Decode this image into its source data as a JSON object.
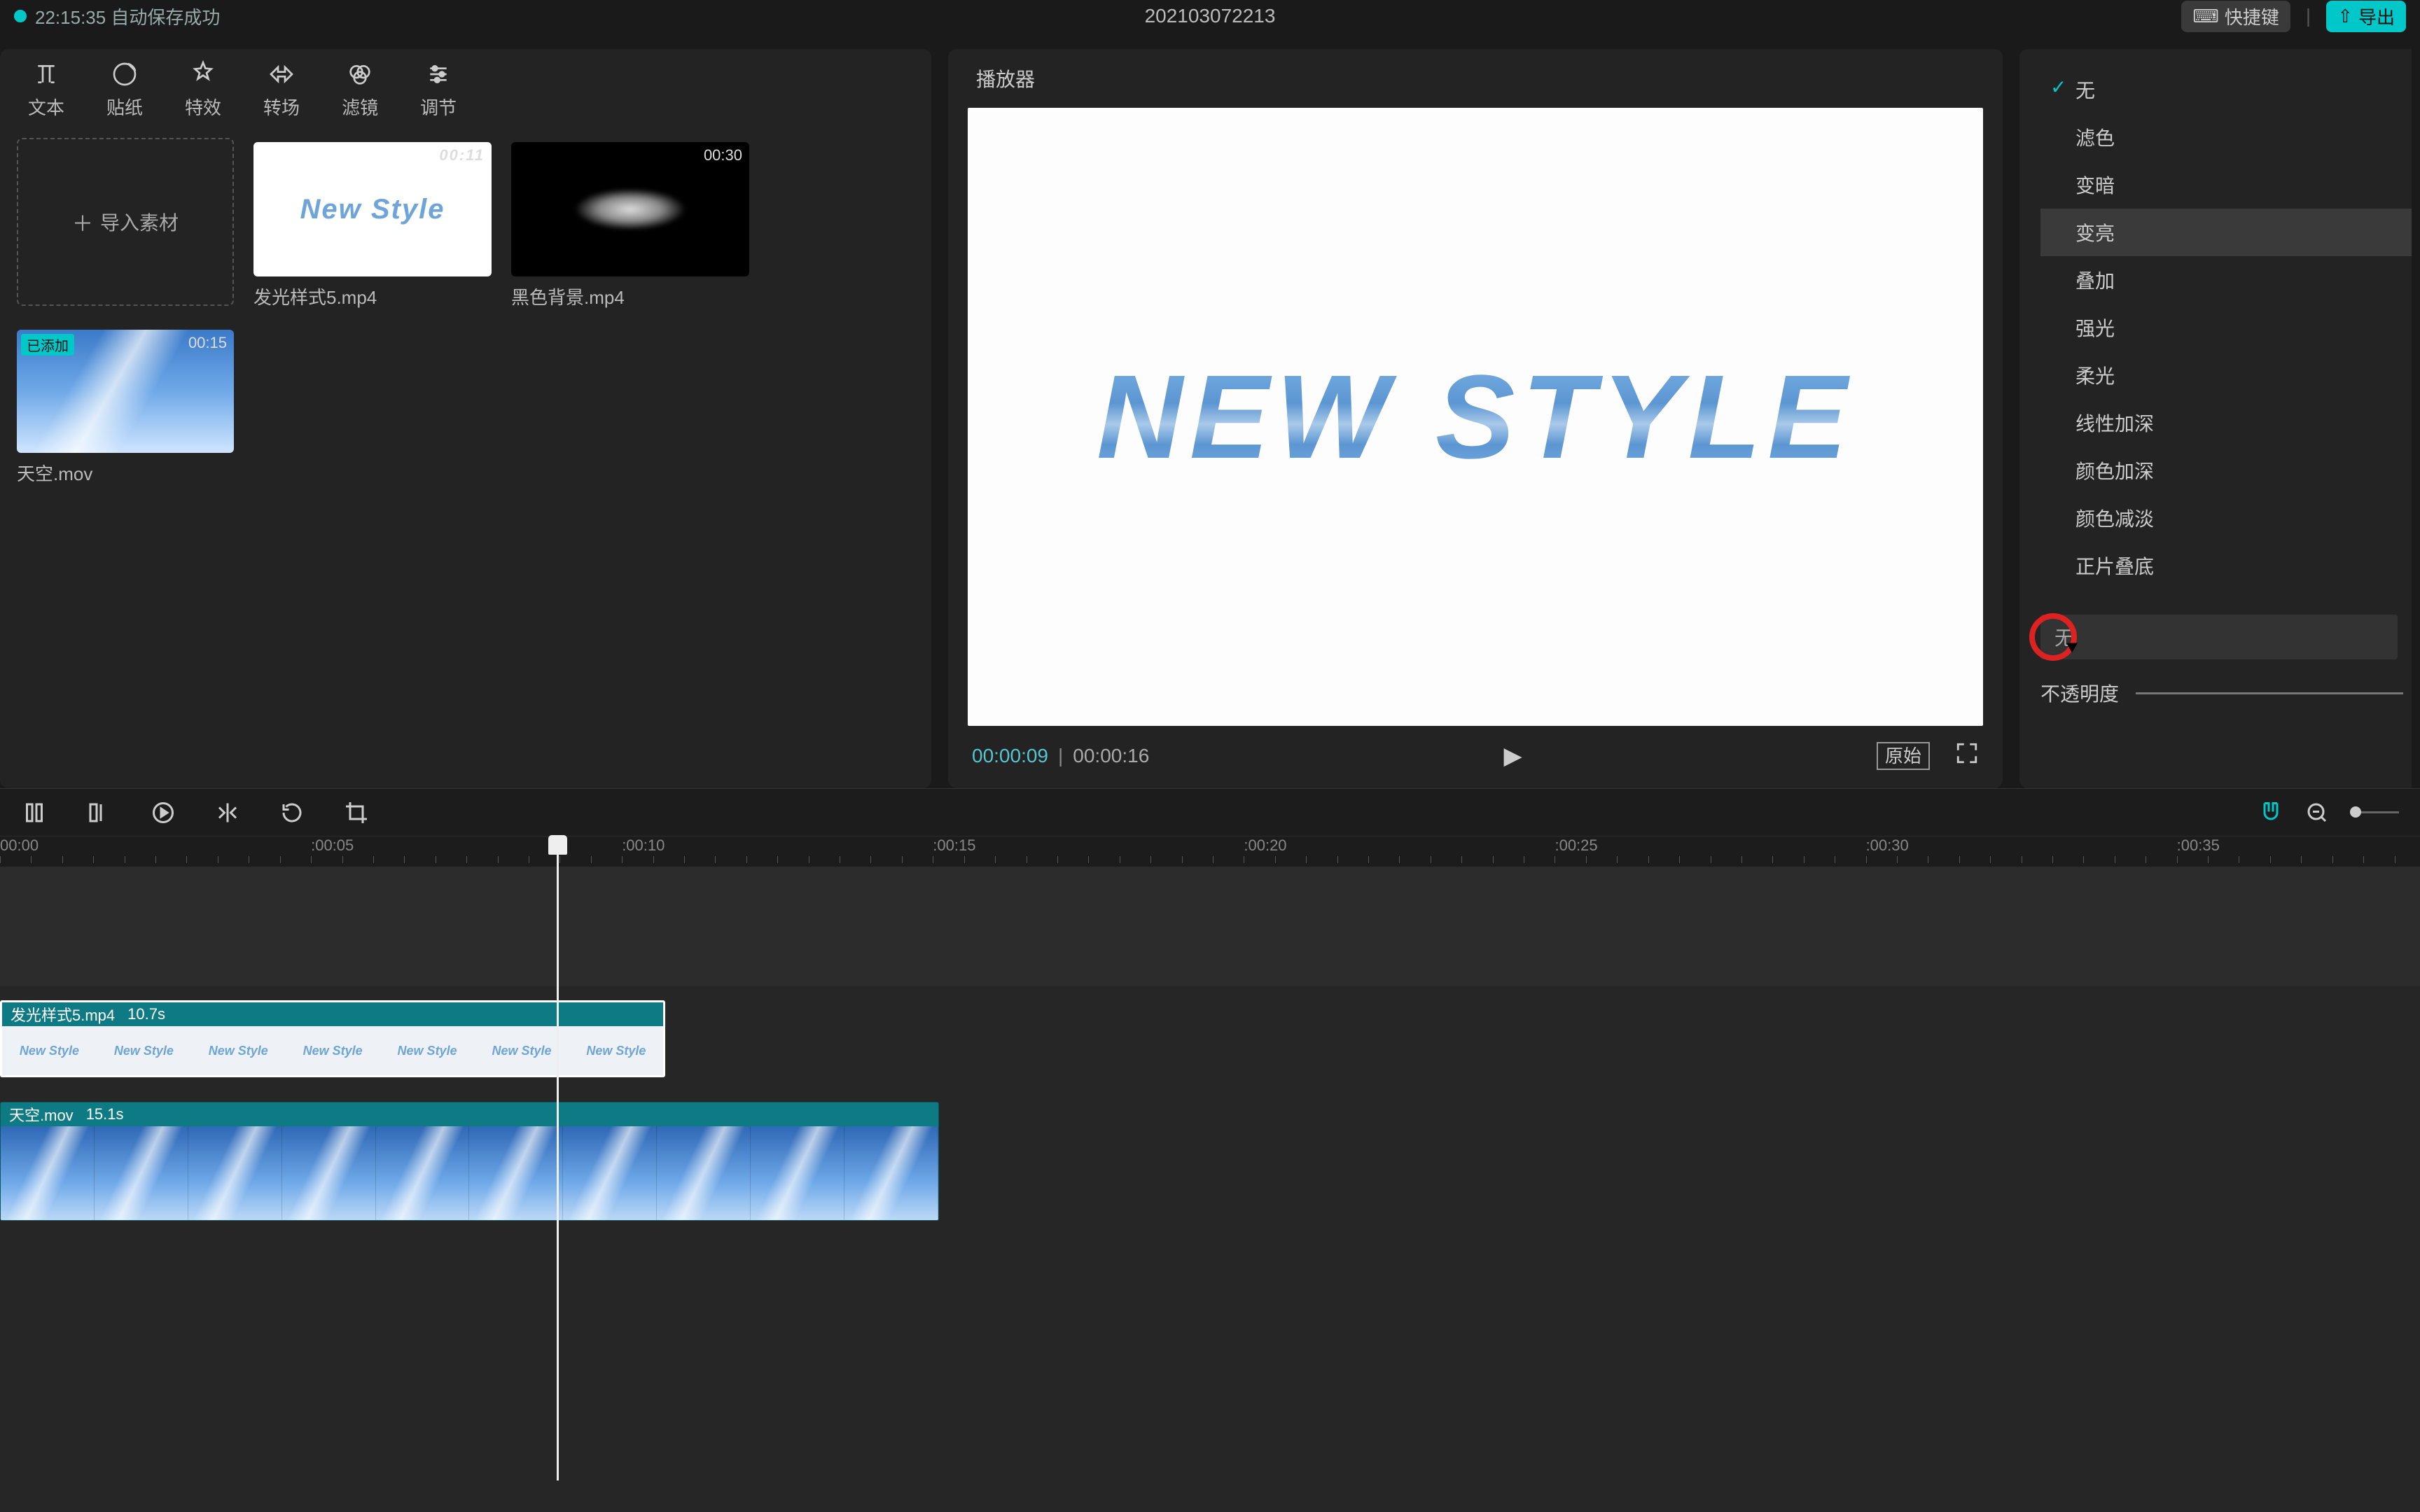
{
  "topbar": {
    "autosave": "22:15:35 自动保存成功",
    "title": "202103072213",
    "shortcut": "快捷键",
    "export": "导出"
  },
  "tabs": [
    {
      "label": "文本",
      "icon": "text"
    },
    {
      "label": "贴纸",
      "icon": "sticker"
    },
    {
      "label": "特效",
      "icon": "fx"
    },
    {
      "label": "转场",
      "icon": "transition"
    },
    {
      "label": "滤镜",
      "icon": "filter"
    },
    {
      "label": "调节",
      "icon": "adjust"
    }
  ],
  "import_label": "导入素材",
  "media": [
    {
      "name": "发光样式5.mp4",
      "dur": "00:11",
      "kind": "newstyle"
    },
    {
      "name": "黑色背景.mp4",
      "dur": "00:30",
      "kind": "black"
    },
    {
      "name": "天空.mov",
      "dur": "00:15",
      "kind": "sky",
      "badge": "已添加"
    }
  ],
  "preview_text": "New Style",
  "player": {
    "title": "播放器",
    "time_cur": "00:00:09",
    "time_dur": "00:00:16",
    "orig": "原始"
  },
  "blend": {
    "items": [
      "无",
      "滤色",
      "变暗",
      "变亮",
      "叠加",
      "强光",
      "柔光",
      "线性加深",
      "颜色加深",
      "颜色减淡",
      "正片叠底"
    ],
    "checked_index": 0,
    "hover_index": 3,
    "selected_label": "无",
    "opacity_label": "不透明度"
  },
  "ruler": [
    {
      "t": "00:00",
      "pct": 0
    },
    {
      "t": ":00:05",
      "pct": 12.85
    },
    {
      "t": ":00:10",
      "pct": 25.7
    },
    {
      "t": ":00:15",
      "pct": 38.55
    },
    {
      "t": ":00:20",
      "pct": 51.4
    },
    {
      "t": ":00:25",
      "pct": 64.25
    },
    {
      "t": ":00:30",
      "pct": 77.1
    },
    {
      "t": ":00:35",
      "pct": 89.95
    }
  ],
  "playhead_pct": 23.0,
  "clips": [
    {
      "track": 0,
      "name": "发光样式5.mp4",
      "dur": "10.7s",
      "kind": "text",
      "start_pct": 0,
      "width_pct": 27.5,
      "selected": true,
      "frames": 7
    },
    {
      "track": 1,
      "name": "天空.mov",
      "dur": "15.1s",
      "kind": "sky",
      "start_pct": 0,
      "width_pct": 38.8,
      "selected": false,
      "frames": 10
    }
  ]
}
